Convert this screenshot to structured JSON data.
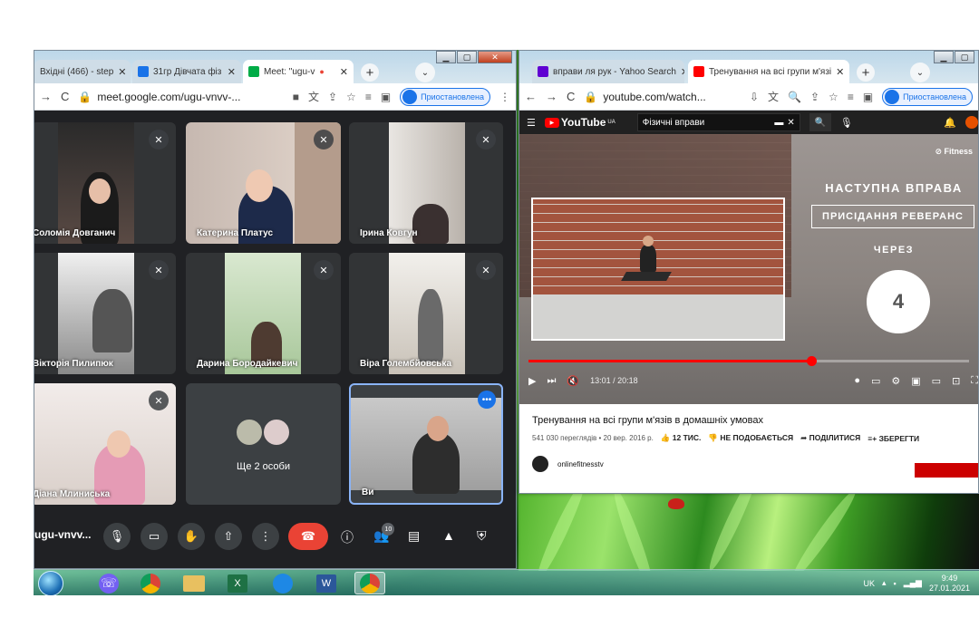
{
  "meet_window": {
    "tabs": [
      {
        "label": "Вхідні (466) - steр",
        "icon_color": "#ea4335"
      },
      {
        "label": "31гр Дівчата фіз",
        "icon_color": "#1a73e8"
      },
      {
        "label": "Meet: \"ugu-v",
        "icon_color": "#00ac47"
      }
    ],
    "url": "meet.google.com/ugu-vnvv-...",
    "profile_label": "Приостановлена",
    "participants": [
      {
        "name": "Соломія Довганич",
        "muted": true
      },
      {
        "name": "Катерина Платус",
        "muted": true
      },
      {
        "name": "Ірина Ковгун",
        "muted": true
      },
      {
        "name": "Вікторія Пилипюк",
        "muted": true
      },
      {
        "name": "Дарина Бородайкевич",
        "muted": true
      },
      {
        "name": "Віра Голембйовська",
        "muted": true
      },
      {
        "name": "Діана Млиниська",
        "muted": true
      },
      {
        "name": "Ще 2 особи",
        "muted": false
      },
      {
        "name": "Ви",
        "muted": false
      }
    ],
    "meeting_code": "ugu-vnvv...",
    "people_count": "10"
  },
  "yt_window": {
    "tabs": [
      {
        "label": "вправи ля рук - Yahoo Search",
        "icon_color": "#6001d2"
      },
      {
        "label": "Тренування на всі групи м'язі",
        "icon_color": "#ff0000"
      }
    ],
    "url": "youtube.com/watch...",
    "profile_label": "Приостановлена",
    "logo": "YouTube",
    "logo_region": "UA",
    "search_value": "Фізичні вправи",
    "video": {
      "next_label": "НАСТУПНА ВПРАВА",
      "exercise": "ПРИСІДАННЯ РЕВЕРАНС",
      "through": "ЧЕРЕЗ",
      "countdown": "4",
      "brand": "Fitness",
      "time": "13:01 / 20:18",
      "progress": 0.641
    },
    "title": "Тренування на всі групи м'язів в домашніх умовах",
    "views": "541 030 переглядів • 20 вер. 2016 р.",
    "likes": "12 ТИС.",
    "dislike": "НЕ ПОДОБАЄТЬСЯ",
    "share": "ПОДІЛИТИСЯ",
    "save": "ЗБЕРЕГТИ",
    "channel": "onlinefitnesstv"
  },
  "taskbar": {
    "language": "UK",
    "time": "9:49",
    "date": "27.01.2021"
  }
}
